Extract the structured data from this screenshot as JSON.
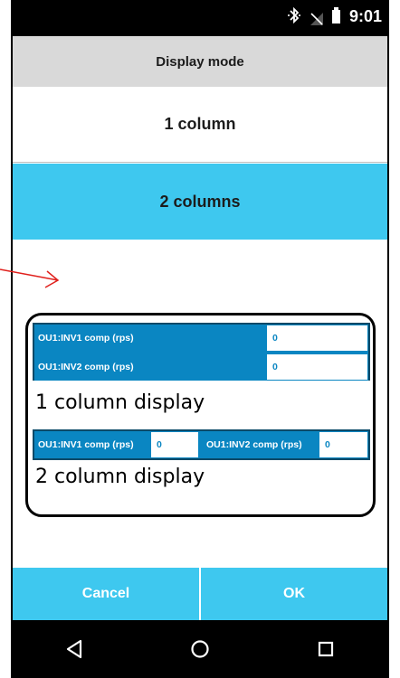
{
  "status_bar": {
    "time": "9:01",
    "icons": [
      "bluetooth-icon",
      "no-signal-icon",
      "battery-icon"
    ]
  },
  "dialog": {
    "title": "Display mode",
    "options": [
      {
        "label": "1 column",
        "selected": false
      },
      {
        "label": "2 columns",
        "selected": true
      }
    ],
    "cancel_label": "Cancel",
    "ok_label": "OK"
  },
  "callout": {
    "one_column": {
      "rows": [
        {
          "label": "OU1:INV1 comp (rps)",
          "value": "0"
        },
        {
          "label": "OU1:INV2 comp (rps)",
          "value": "0"
        }
      ],
      "caption": "1 column display"
    },
    "two_column": {
      "cells": [
        {
          "label": "OU1:INV1 comp (rps)",
          "value": "0"
        },
        {
          "label": "OU1:INV2 comp (rps)",
          "value": "0"
        }
      ],
      "caption": "2 column display"
    }
  },
  "nav_bar": {
    "icons": [
      "back-icon",
      "home-icon",
      "recents-icon"
    ]
  },
  "colors": {
    "accent": "#3ec8ef",
    "cell_blue": "#0a86c2",
    "annotation_red": "#e0201c"
  }
}
